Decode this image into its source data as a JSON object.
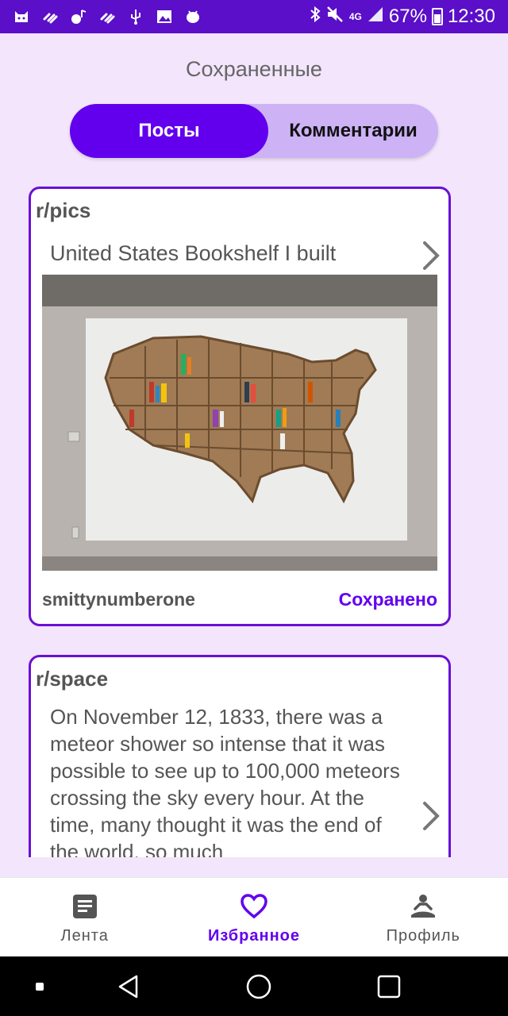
{
  "status_bar": {
    "battery": "67%",
    "time": "12:30",
    "network": "4G"
  },
  "header": {
    "title": "Сохраненные"
  },
  "tabs": {
    "posts": "Посты",
    "comments": "Комментарии",
    "active": "posts"
  },
  "posts": [
    {
      "subreddit": "r/pics",
      "title": "United States Bookshelf I built",
      "author": "smittynumberone",
      "saved_label": "Сохранено"
    },
    {
      "subreddit": "r/space",
      "text": "On November 12, 1833, there was a meteor shower so intense that it was possible to see up to 100,000 meteors crossing the sky every hour. At the time, many thought it was the end of the world, so much"
    }
  ],
  "bottom_nav": {
    "feed": "Лента",
    "favorites": "Избранное",
    "profile": "Профиль",
    "active": "favorites"
  },
  "colors": {
    "accent": "#6200ee",
    "status_bar": "#5b0fc8",
    "background": "#f3e5fc",
    "tab_inactive_bg": "#cdb2f6"
  }
}
